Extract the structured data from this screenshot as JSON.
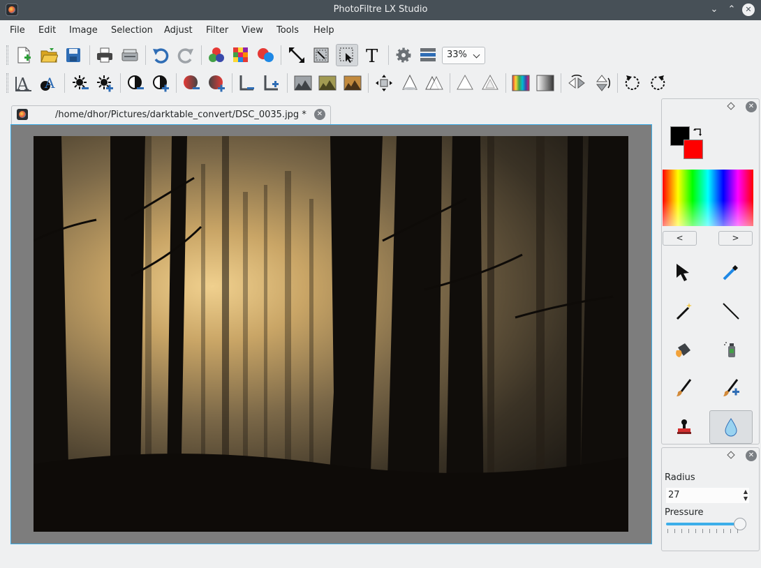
{
  "window": {
    "title": "PhotoFiltre LX Studio"
  },
  "menu": [
    "File",
    "Edit",
    "Image",
    "Selection",
    "Adjust",
    "Filter",
    "View",
    "Tools",
    "Help"
  ],
  "toolbar": {
    "zoom_value": "33%"
  },
  "document": {
    "tab_label": "/home/dhor/Pictures/darktable_convert/DSC_0035.jpg *"
  },
  "colors": {
    "foreground": "#000000",
    "background": "#ff0000",
    "accent": "#3daee9"
  },
  "palette": {
    "prev_label": "<",
    "next_label": ">"
  },
  "tools": [
    "arrow-select",
    "color-picker",
    "magic-wand",
    "line",
    "paint-bucket",
    "spray",
    "brush",
    "advanced-brush",
    "clone-stamp",
    "blur-drop"
  ],
  "tool_options": {
    "radius_label": "Radius",
    "radius_value": "27",
    "pressure_label": "Pressure",
    "pressure_level": 0.95
  }
}
